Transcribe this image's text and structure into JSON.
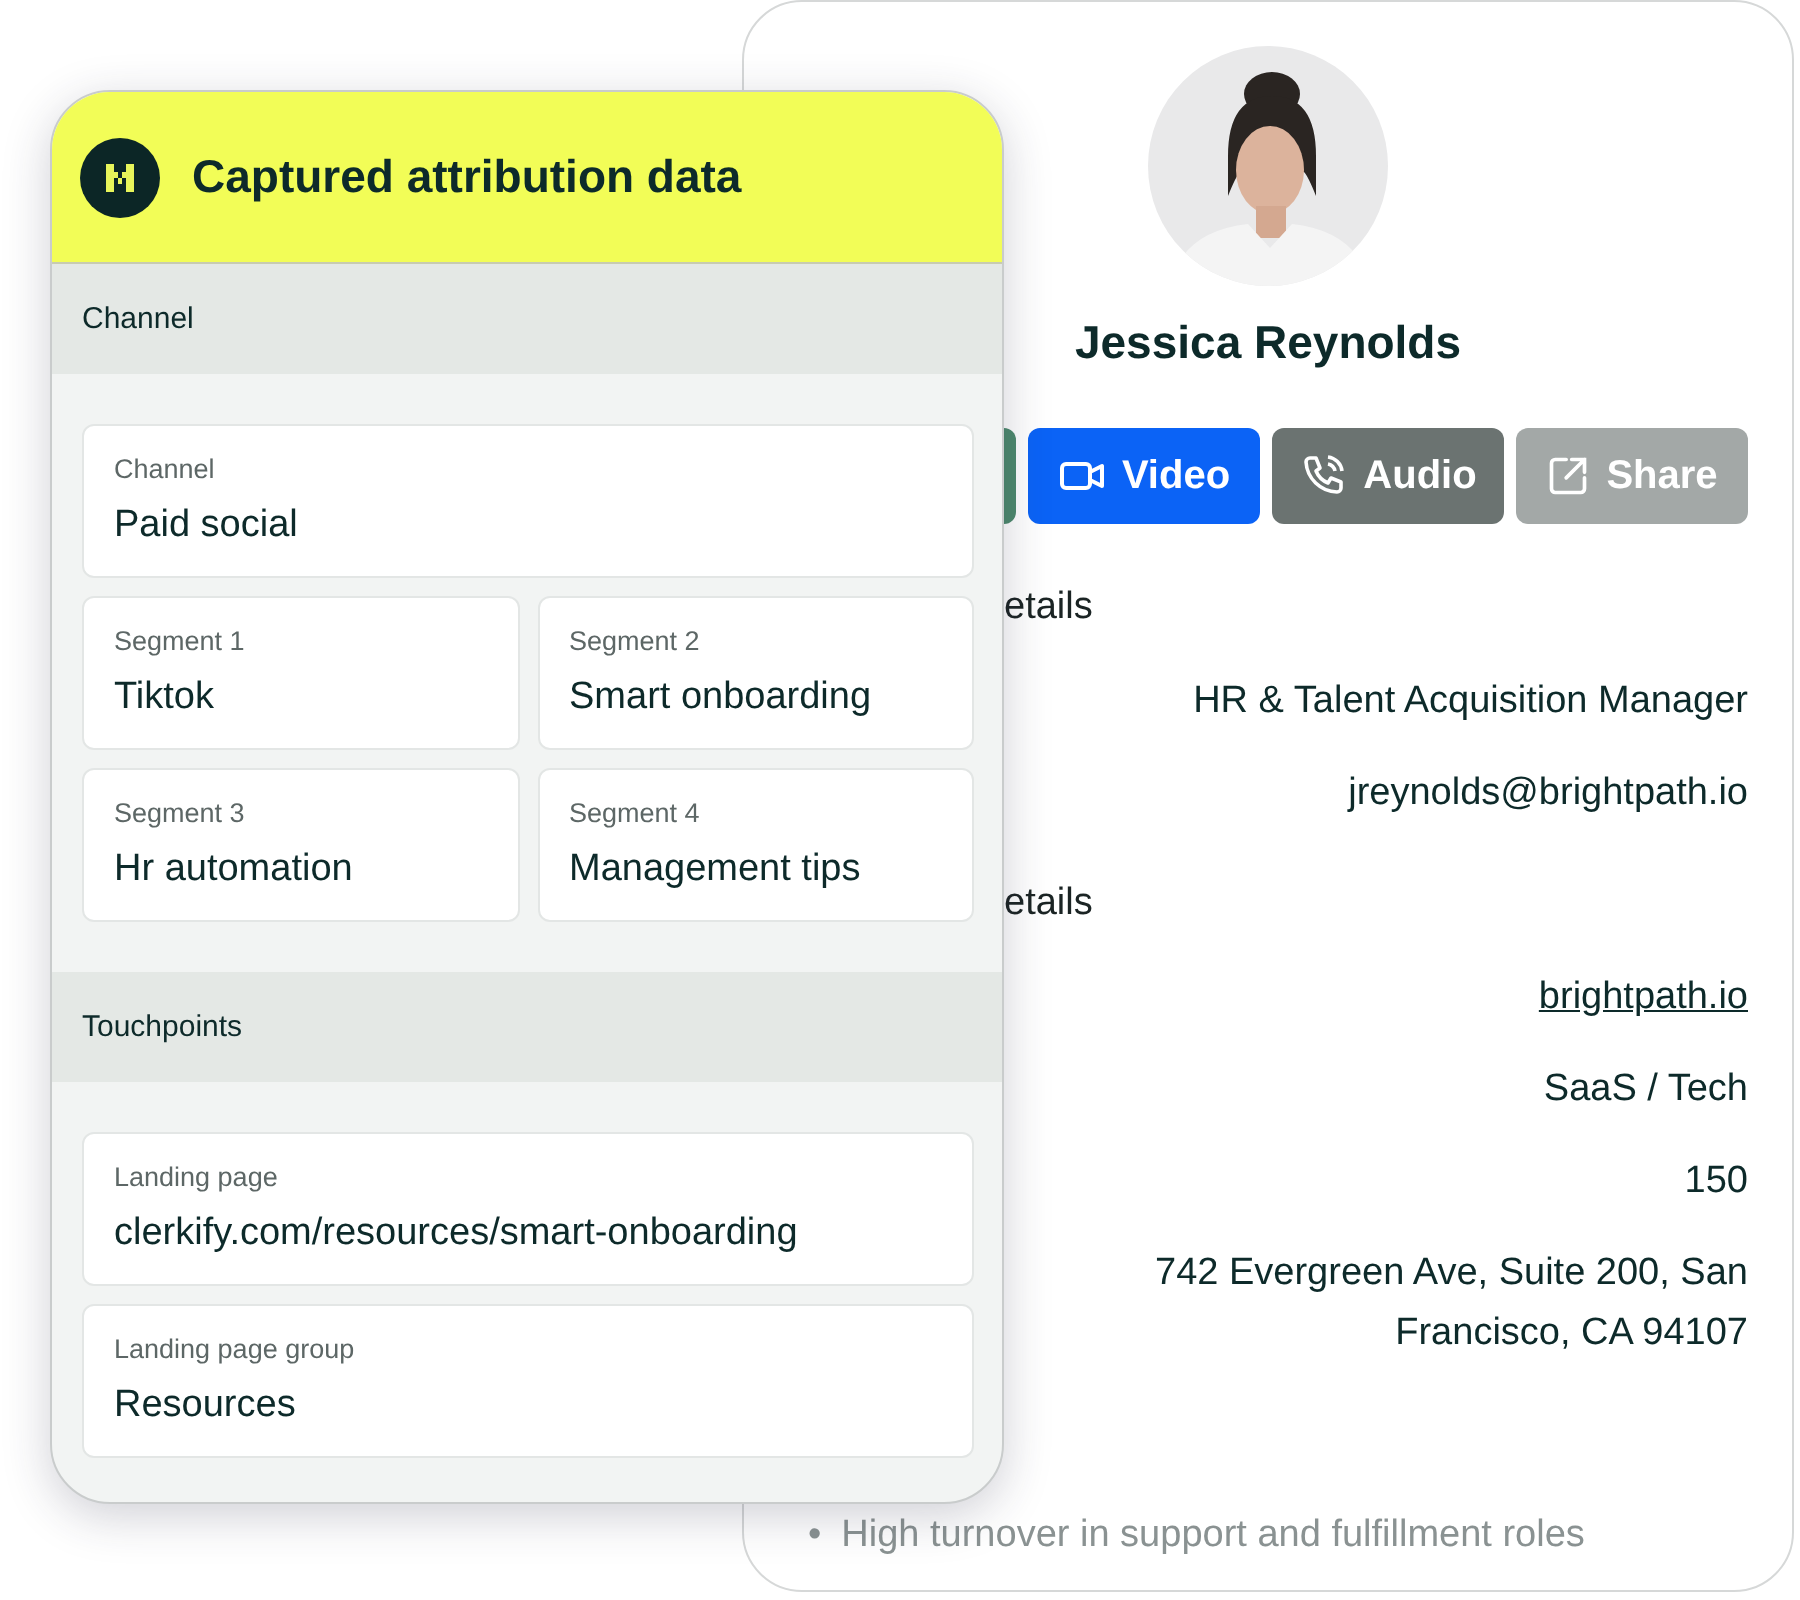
{
  "profile": {
    "name": "Jessica Reynolds",
    "buttons": [
      "Video",
      "Audio",
      "Share"
    ],
    "sections": [
      {
        "heading": "etails",
        "rows": [
          {
            "kind": "text",
            "value": "HR & Talent Acquisition Manager"
          },
          {
            "kind": "text",
            "value": "jreynolds@brightpath.io"
          }
        ]
      },
      {
        "heading": "etails",
        "rows": [
          {
            "kind": "link",
            "value": "brightpath.io"
          },
          {
            "kind": "text",
            "value": "SaaS / Tech"
          },
          {
            "kind": "text",
            "value": "150"
          },
          {
            "kind": "text",
            "value": "742 Evergreen Ave, Suite 200, San Francisco, CA 94107"
          }
        ]
      }
    ],
    "bullets": [
      {
        "marker": "•",
        "text": "High turnover in support and fulfillment roles"
      }
    ]
  },
  "attribution_card": {
    "title": "Captured attribution data",
    "sections": [
      {
        "heading": "Channel",
        "rows": [
          [
            {
              "label": "Channel",
              "value": "Paid social"
            }
          ],
          [
            {
              "label": "Segment 1",
              "value": "Tiktok"
            },
            {
              "label": "Segment 2",
              "value": "Smart onboarding"
            }
          ],
          [
            {
              "label": "Segment 3",
              "value": "Hr automation"
            },
            {
              "label": "Segment 4",
              "value": "Management tips"
            }
          ]
        ]
      },
      {
        "heading": "Touchpoints",
        "rows": [
          [
            {
              "label": "Landing page",
              "value": "clerkify.com/resources/smart-onboarding"
            }
          ],
          [
            {
              "label": "Landing page group",
              "value": "Resources"
            }
          ]
        ]
      }
    ]
  }
}
